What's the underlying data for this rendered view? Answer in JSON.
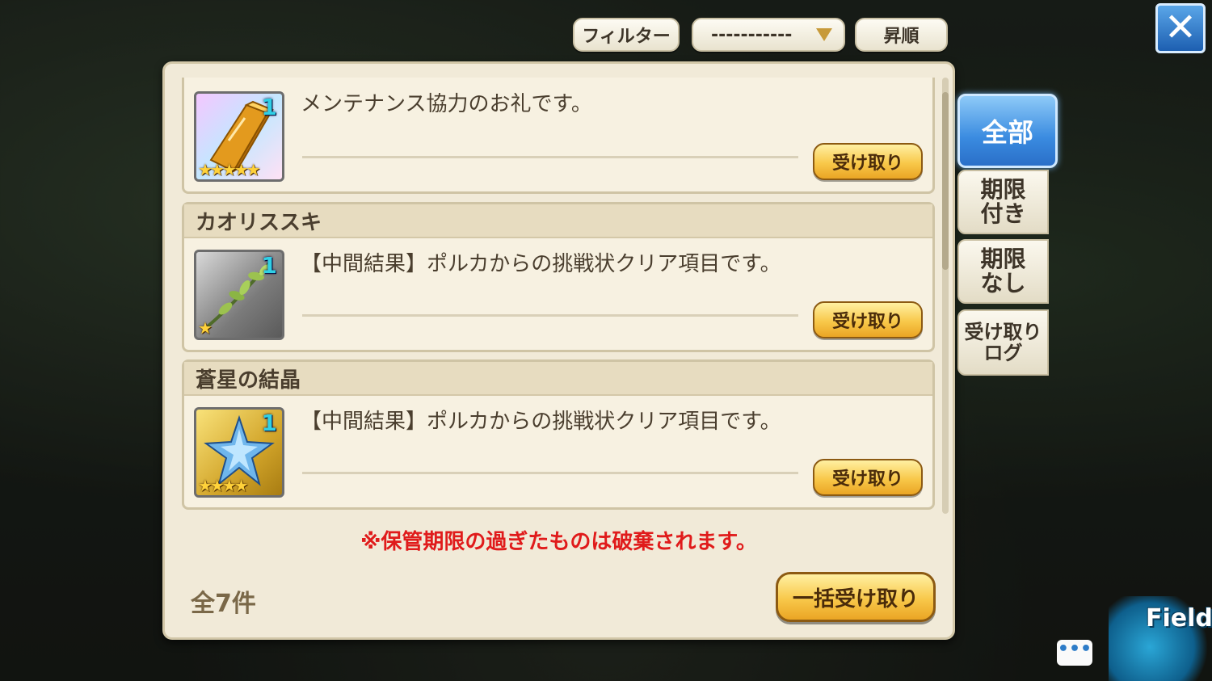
{
  "toolbar": {
    "filter_label": "フィルター",
    "sort_select_value": "-----------",
    "sort_order_label": "昇順",
    "close_icon": "✕"
  },
  "tabs": [
    {
      "label": "全部",
      "active": true
    },
    {
      "label": "期限付き",
      "active": false
    },
    {
      "label": "期限なし",
      "active": false
    },
    {
      "label": "受け取りログ",
      "active": false
    }
  ],
  "mail_items": [
    {
      "title": "",
      "message": "メンテナンス協力のお礼です。",
      "count": "1",
      "stars": "★★★★★",
      "icon": "gold-bar-icon",
      "claim_label": "受け取り"
    },
    {
      "title": "カオリススキ",
      "message": "【中間結果】ポルカからの挑戦状クリア項目です。",
      "count": "1",
      "stars": "★",
      "icon": "herb-sprig-icon",
      "claim_label": "受け取り"
    },
    {
      "title": "蒼星の結晶",
      "message": "【中間結果】ポルカからの挑戦状クリア項目です。",
      "count": "1",
      "stars": "★★★★",
      "icon": "blue-star-crystal-icon",
      "claim_label": "受け取り"
    }
  ],
  "footer": {
    "warning": "※保管期限の過ぎたものは破棄されます。",
    "total": "全7件",
    "bulk_claim_label": "一括受け取り"
  },
  "corner": {
    "chat_icon": "•••",
    "field_label": "Field"
  },
  "colors": {
    "accent_blue": "#3a8be0",
    "claim_gold": "#f8c84a",
    "warning_red": "#e01b1b",
    "count_cyan": "#2fd0e6"
  }
}
